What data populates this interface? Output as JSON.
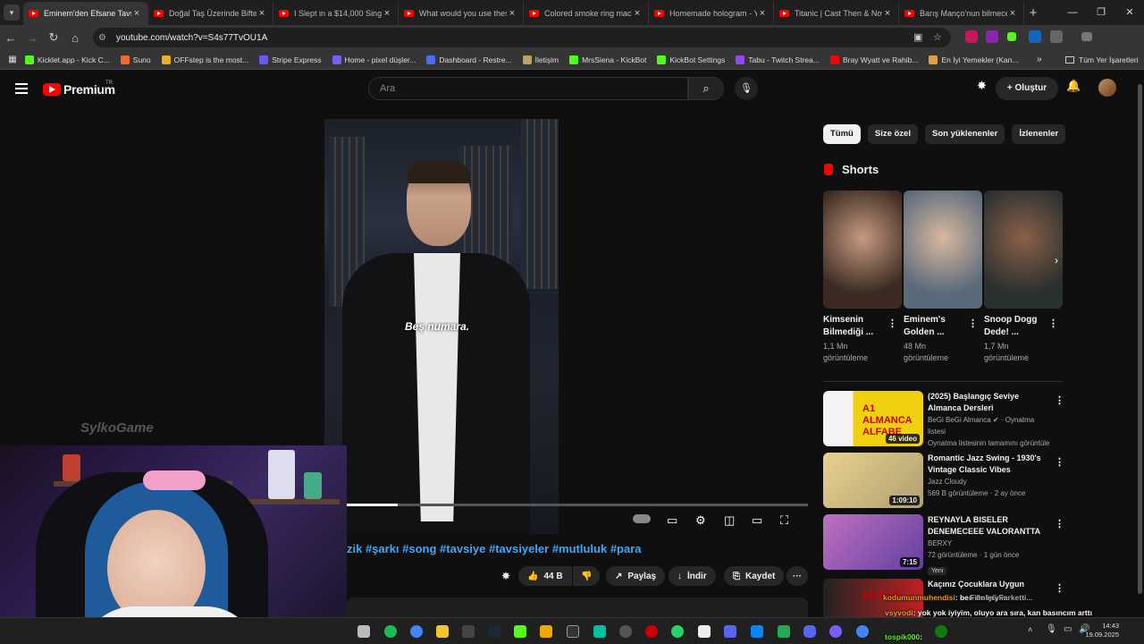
{
  "browser": {
    "tabs": [
      {
        "title": "Eminem'den Efsane Tavsiye",
        "active": true
      },
      {
        "title": "Doğal Taş Üzerinde Bifteki"
      },
      {
        "title": "I Slept in a $14,000 Singa..."
      },
      {
        "title": "What would you use these..."
      },
      {
        "title": "Colored smoke ring mach..."
      },
      {
        "title": "Homemade hologram - Yo..."
      },
      {
        "title": "Titanic | Cast Then & Now"
      },
      {
        "title": "Barış Manço'nun bilmece..."
      }
    ],
    "url": "youtube.com/watch?v=S4s77TvOU1A",
    "bookmarks": [
      {
        "label": "Kicklet.app - Kick C...",
        "color": "#53fc18"
      },
      {
        "label": "Suno",
        "color": "#f36b2a"
      },
      {
        "label": "OFFstep is the most...",
        "color": "#e8b020"
      },
      {
        "label": "Stripe Express",
        "color": "#635bff"
      },
      {
        "label": "Home - pixel düşler...",
        "color": "#7a5cff"
      },
      {
        "label": "Dashboard - Restre...",
        "color": "#4a6cf7"
      },
      {
        "label": "İletişim",
        "color": "#c0a060"
      },
      {
        "label": "MrsSiena - KickBot",
        "color": "#53fc18"
      },
      {
        "label": "KickBot Settings",
        "color": "#53fc18"
      },
      {
        "label": "Tabu - Twitch Strea...",
        "color": "#9146ff"
      },
      {
        "label": "Bray Wyatt ve Rahib...",
        "color": "#ff0000"
      },
      {
        "label": "En İyi Yemekler (Kan...",
        "color": "#e0a040"
      }
    ],
    "all_bookmarks": "Tüm Yer İşaretleri"
  },
  "youtube": {
    "logo": "Premium",
    "region": "TR",
    "search_placeholder": "Ara",
    "create_label": "Oluştur",
    "video": {
      "subtitle": "Beş numara.",
      "progress": 0.11,
      "watermark": "SylkoGame",
      "hashtags": "zik #şarkı #song #tavsiye #tavsiyeler #mutluluk #para",
      "like_count": "44 B",
      "share_label": "Paylaş",
      "download_label": "İndir",
      "save_label": "Kaydet"
    },
    "chips": [
      "Tümü",
      "Size özel",
      "Son yüklenenler",
      "İzlenenler"
    ],
    "shorts_heading": "Shorts",
    "shorts": [
      {
        "title": "Kimsenin Bilmediği ...",
        "views": "1,1 Mn görüntüleme"
      },
      {
        "title": "Eminem's Golden ...",
        "views": "48 Mn görüntüleme"
      },
      {
        "title": "Snoop Dogg Dede! ...",
        "views": "1,7 Mn görüntüleme"
      }
    ],
    "recommendations": [
      {
        "title": "(2025) Başlangıç Seviye Almanca Dersleri",
        "channel": "BeGi BeGi Almanca ✔ · Oynatma listesi",
        "meta": "Oynatma listesinin tamamını görüntüle",
        "duration": "46 video",
        "thumb_text": "A1 ALMANCA ALFABE"
      },
      {
        "title": "Romantic Jazz Swing - 1930's Vintage Classic Vibes",
        "channel": "Jazz Cloudy",
        "meta": "569 B görüntüleme · 2 ay önce",
        "duration": "1:09:10"
      },
      {
        "title": "REYNAYLA BISELER DENEMECEEE VALORANTTA",
        "channel": "BERXY",
        "meta": "72 görüntüleme · 1 gün önce",
        "badge": "Yeni",
        "duration": "7:15"
      },
      {
        "title": "Kaçınız Çocuklara Uygun",
        "channel": "",
        "meta": "",
        "thumb_text": "KENDİN"
      }
    ]
  },
  "stream_chat": [
    {
      "user": "kodumunmuhendisi",
      "text": ": ben de iyiyim"
    },
    {
      "user": "vsyvodi",
      "text": ": yok yok iyiyim, oluyo ara sıra, kan basıncım arttı herhalde, hastayım zaten"
    },
    {
      "user": "tospik000",
      "text": ":"
    }
  ],
  "stream_overlay_fragment": "Filmleri Farketti...",
  "taskbar": {
    "time": "14:43",
    "date": "19.09.2025"
  }
}
